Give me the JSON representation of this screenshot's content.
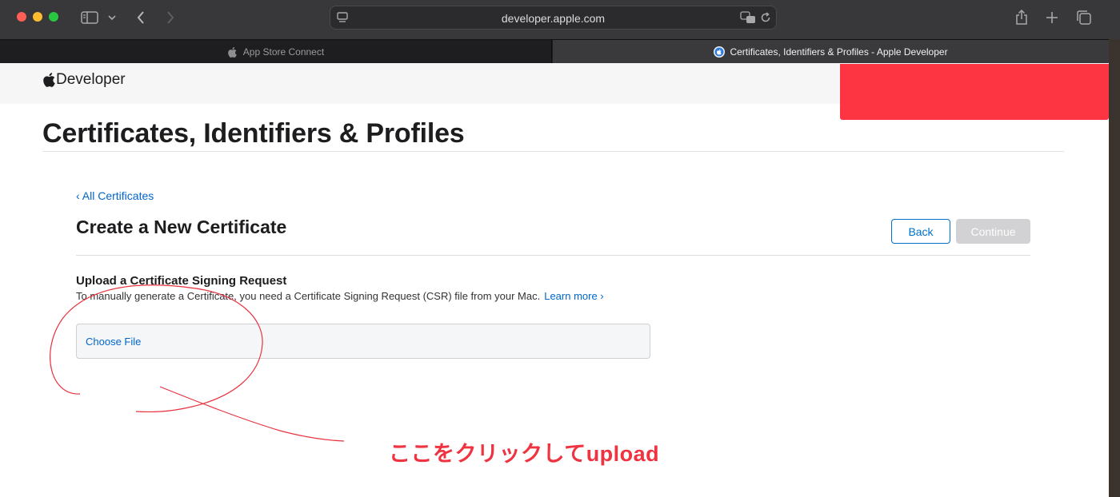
{
  "browser": {
    "url": "developer.apple.com",
    "tabs": [
      {
        "label": "App Store Connect",
        "active": false
      },
      {
        "label": "Certificates, Identifiers & Profiles - Apple Developer",
        "active": true
      }
    ]
  },
  "globalnav": {
    "logo_text": "Developer"
  },
  "page": {
    "title": "Certificates, Identifiers & Profiles",
    "back_link": "‹ All Certificates",
    "subtitle": "Create a New Certificate",
    "buttons": {
      "back": "Back",
      "continue": "Continue"
    },
    "upload": {
      "heading": "Upload a Certificate Signing Request",
      "description": "To manually generate a Certificate, you need a Certificate Signing Request (CSR) file from your Mac.",
      "learn_more": "Learn more ›",
      "choose_file": "Choose File"
    }
  },
  "annotation": {
    "text": "ここをクリックしてupload",
    "color": "#ef3340"
  },
  "colors": {
    "link": "#0066cc",
    "redaction": "#fd3441",
    "disabled_button": "#d2d2d4"
  }
}
